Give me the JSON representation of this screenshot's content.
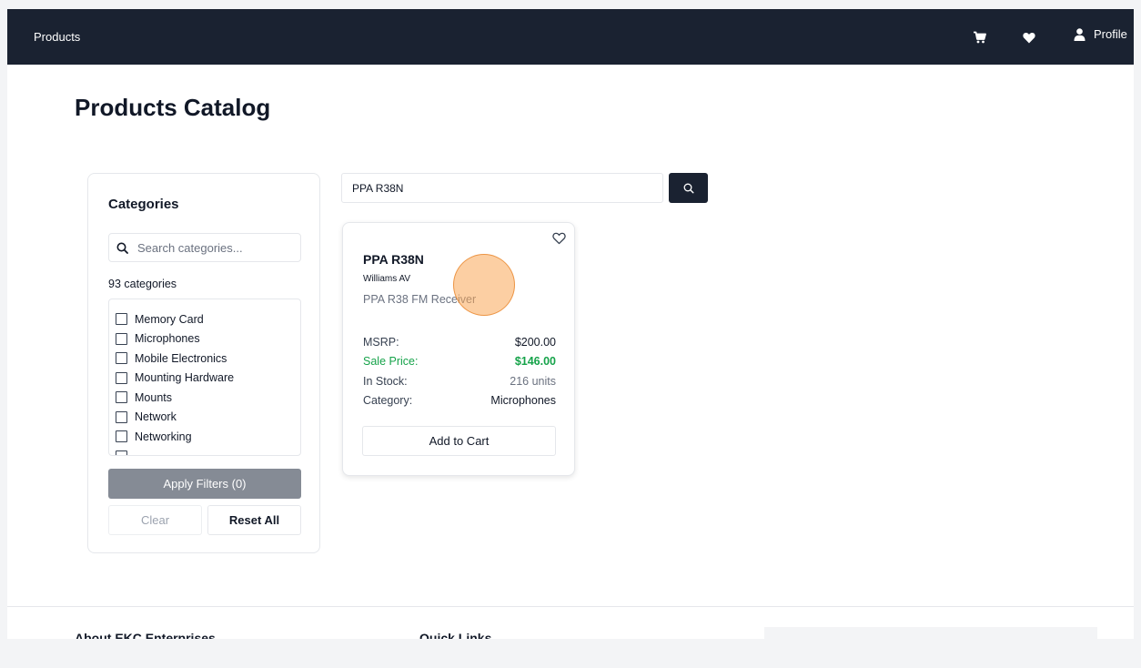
{
  "header": {
    "brand": "Products",
    "icons": [
      "cart-icon",
      "heart-icon",
      "user-icon"
    ],
    "profile_label": "Profile"
  },
  "page": {
    "title": "Products Catalog"
  },
  "sidebar": {
    "title": "Categories",
    "search_placeholder": "Search categories...",
    "count_text": "93 categories",
    "items": [
      {
        "label": "Memory Card",
        "checked": false
      },
      {
        "label": "Microphones",
        "checked": false
      },
      {
        "label": "Mobile Electronics",
        "checked": false
      },
      {
        "label": "Mounting Hardware",
        "checked": false
      },
      {
        "label": "Mounts",
        "checked": false
      },
      {
        "label": "Network",
        "checked": false
      },
      {
        "label": "Networking",
        "checked": false
      },
      {
        "label": "",
        "checked": false
      }
    ],
    "apply_label": "Apply Filters (0)",
    "clear_label": "Clear",
    "reset_label": "Reset All"
  },
  "search": {
    "value": "PPA R38N"
  },
  "product": {
    "name": "PPA R38N",
    "brand": "Williams AV",
    "description": "PPA R38 FM Receiver",
    "msrp_label": "MSRP:",
    "msrp": "$200.00",
    "sale_label": "Sale Price:",
    "sale": "$146.00",
    "stock_label": "In Stock:",
    "stock": "216 units",
    "category_label": "Category:",
    "category": "Microphones",
    "cart_label": "Add to Cart"
  },
  "footer": {
    "about": "About EKC Enterprises",
    "links": "Quick Links"
  },
  "colors": {
    "navbar": "#1a2231",
    "sale": "#16a34a",
    "apply_button": "#858b95",
    "cursor": "#f9a858"
  }
}
